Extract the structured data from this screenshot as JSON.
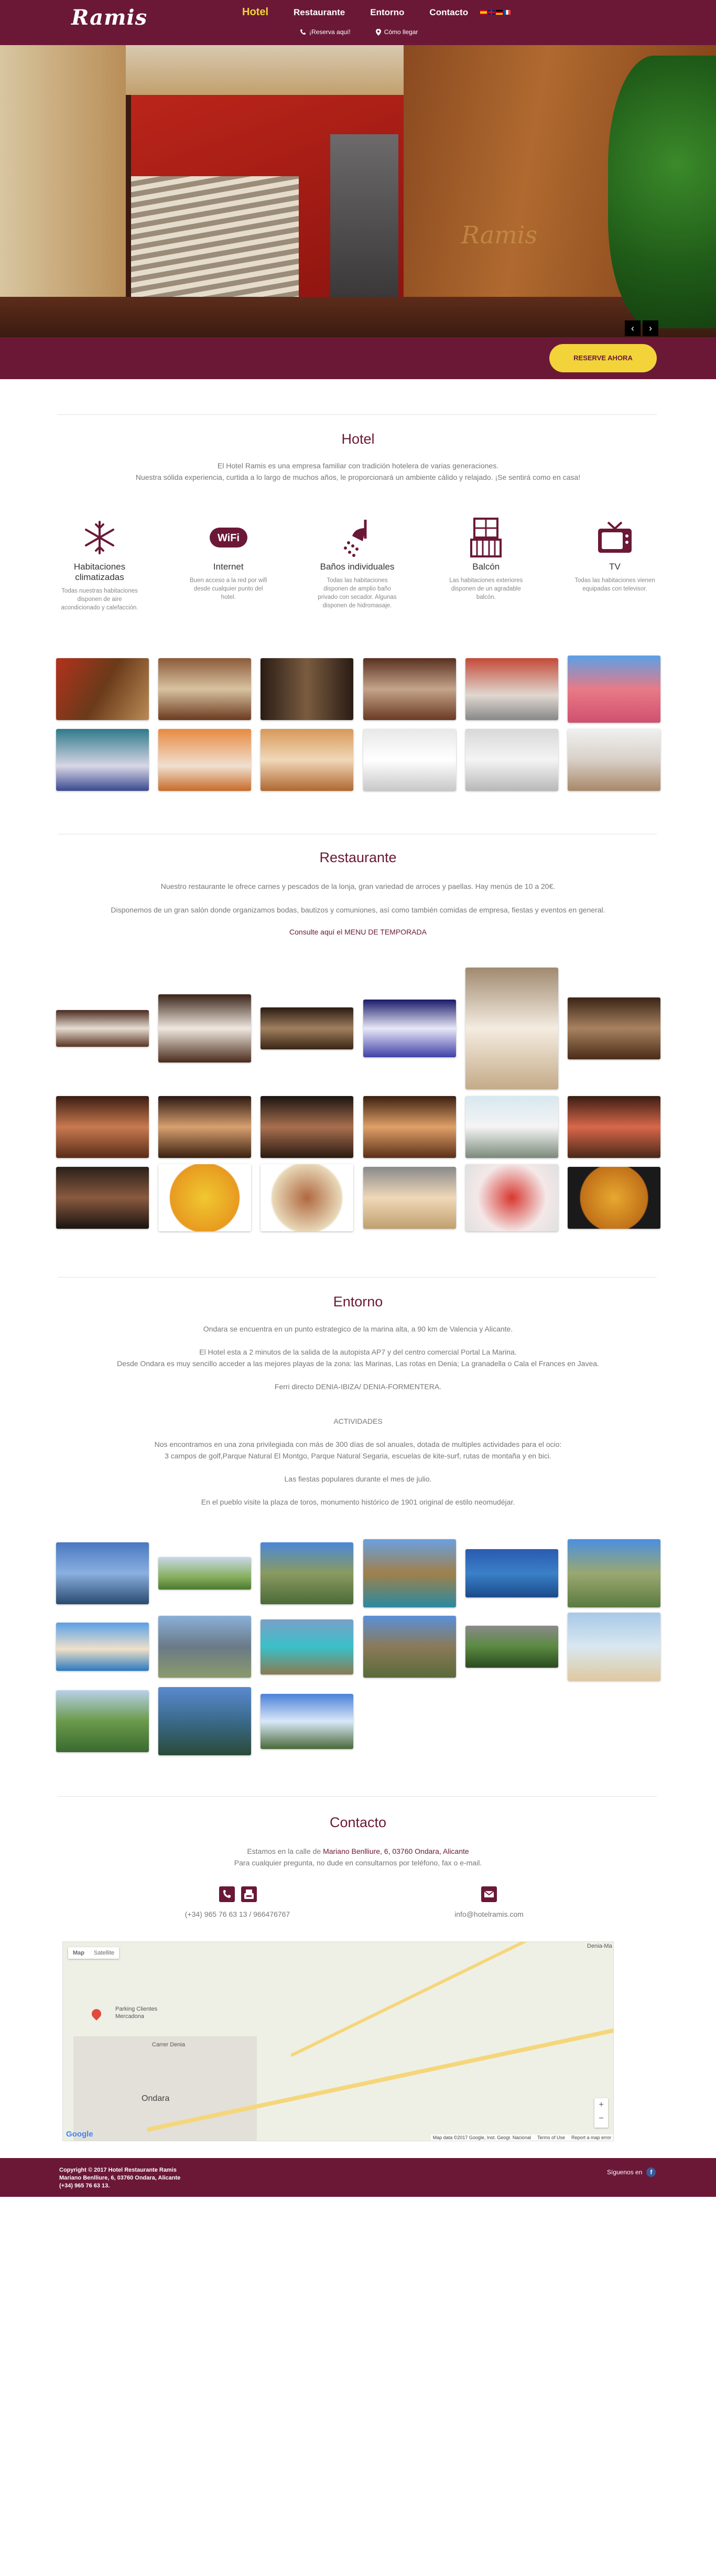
{
  "header": {
    "logo": "Ramis",
    "nav": [
      "Hotel",
      "Restaurante",
      "Entorno",
      "Contacto"
    ],
    "reserve": "¡Reserva aquí!",
    "directions": "Cómo llegar"
  },
  "hero": {
    "wood_logo": "Ramis"
  },
  "booking": {
    "button": "RESERVE AHORA"
  },
  "hotel": {
    "title": "Hotel",
    "line1": "El Hotel Ramis es una empresa familiar con tradición hotelera de varias generaciones.",
    "line2": "Nuestra sólida experiencia, curtida a lo largo de muchos años, le proporcionará un ambiente cálido y relajado. ¡Se sentirá como en casa!",
    "features": [
      {
        "title": "Habitaciones climatizadas",
        "desc": "Todas nuestras habitaciones disponen de aire acondicionado y calefacción.",
        "icon": "snowflake-icon"
      },
      {
        "title": "Internet",
        "desc": "Buen acceso a la red por wifi desde cualquier punto del hotel.",
        "icon": "wifi-icon"
      },
      {
        "title": "Baños individuales",
        "desc": "Todas las habitaciones disponen de amplio baño privado con secador. Algunas disponen de hidromasaje.",
        "icon": "shower-icon"
      },
      {
        "title": "Balcón",
        "desc": "Las habitaciones exteriores disponen de un agradable balcón.",
        "icon": "balcony-icon"
      },
      {
        "title": "TV",
        "desc": "Todas las habitaciones vienen equipadas con televisor.",
        "icon": "tv-icon"
      }
    ]
  },
  "restaurant": {
    "title": "Restaurante",
    "line1": "Nuestro restaurante le ofrece carnes y pescados de la lonja, gran variedad de arroces y paellas. Hay menús de 10 a 20€.",
    "line2": "Disponemos de un gran salón donde organizamos bodas, bautizos y comuniones, así como también comidas de empresa, fiestas y eventos en general.",
    "menu_prefix": "Consulte aquí el ",
    "menu_link": "MENU DE TEMPORADA"
  },
  "surroundings": {
    "title": "Entorno",
    "line1": "Ondara se encuentra en un punto estrategico de la marina alta, a 90 km de Valencia y Alicante.",
    "line2": "El Hotel esta a 2 minutos de la salida de la autopista AP7 y del centro comercial Portal La Marina.",
    "line3": "Desde Ondara es muy sencillo acceder a las mejores playas de la zona: las Marinas, Las rotas en Denia; La granadella o Cala el Frances en Javea.",
    "line4": "Ferri directo DENIA-IBIZA/ DENIA-FORMENTERA.",
    "activities_title": "ACTIVIDADES",
    "line5": "Nos encontramos en una zona privilegiada con más de 300 días de sol anuales, dotada de multiples actividades para el ocio:",
    "line6": "3 campos de golf,Parque Natural El Montgo, Parque Natural Segaria, escuelas de kite-surf, rutas de montaña y en bici.",
    "line7": "Las fiestas populares durante el mes de julio.",
    "line8": "En el pueblo visite la plaza de toros, monumento histórico de 1901 original de estilo neomudéjar."
  },
  "contact": {
    "title": "Contacto",
    "address_prefix": "Estamos en la calle de ",
    "address": "Mariano Benlliure, 6, 03760 Ondara, Alicante",
    "line2": "Para cualquier pregunta, no dude en consultarnos por teléfono, fax o e-mail.",
    "phone": "(+34) 965 76 63 13 / 966476767",
    "email": "info@hotelramis.com"
  },
  "map": {
    "type_map": "Map",
    "type_satellite": "Satellite",
    "label_parking": "Parking Clientes",
    "label_mercadona": "Mercadona",
    "label_ondara": "Ondara",
    "label_denia": "Denia-Ma",
    "label_carrer": "Carrer Denia",
    "credits": "Map data ©2017 Google, Inst. Geogr. Nacional",
    "terms": "Terms of Use",
    "report": "Report a map error",
    "google": "Google"
  },
  "footer": {
    "line1": "Copyright © 2017 Hotel Restaurante Ramis",
    "line2": "Mariano Benlliure, 6, 03760 Ondara, Alicante",
    "line3": "(+34) 965 76 63 13.",
    "follow": "Síguenos en"
  },
  "colors": {
    "brand": "#6b1837",
    "accent": "#f2d33a"
  }
}
